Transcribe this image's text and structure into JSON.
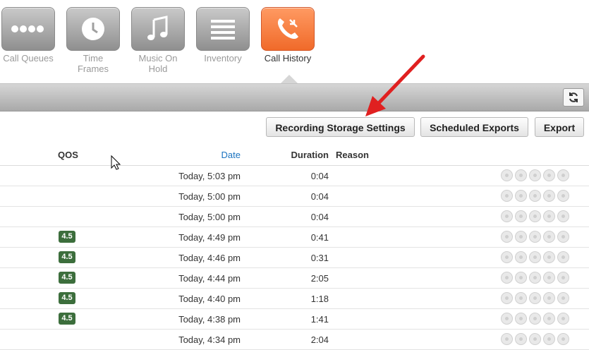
{
  "apps": [
    {
      "label": "Call Queues",
      "icon": "dots-icon",
      "active": false
    },
    {
      "label": "Time\nFrames",
      "icon": "clock-icon",
      "active": false
    },
    {
      "label": "Music On\nHold",
      "icon": "music-note-icon",
      "active": false
    },
    {
      "label": "Inventory",
      "icon": "list-icon",
      "active": false
    },
    {
      "label": "Call History",
      "icon": "phone-history-icon",
      "active": true
    }
  ],
  "toolbar": {
    "recording_storage_label": "Recording Storage Settings",
    "scheduled_exports_label": "Scheduled Exports",
    "export_label": "Export"
  },
  "table": {
    "headers": {
      "qos": "QOS",
      "date": "Date",
      "duration": "Duration",
      "reason": "Reason"
    },
    "rows": [
      {
        "qos": "",
        "date": "Today, 5:03 pm",
        "duration": "0:04"
      },
      {
        "qos": "",
        "date": "Today, 5:00 pm",
        "duration": "0:04"
      },
      {
        "qos": "",
        "date": "Today, 5:00 pm",
        "duration": "0:04"
      },
      {
        "qos": "4.5",
        "date": "Today, 4:49 pm",
        "duration": "0:41"
      },
      {
        "qos": "4.5",
        "date": "Today, 4:46 pm",
        "duration": "0:31"
      },
      {
        "qos": "4.5",
        "date": "Today, 4:44 pm",
        "duration": "2:05"
      },
      {
        "qos": "4.5",
        "date": "Today, 4:40 pm",
        "duration": "1:18"
      },
      {
        "qos": "4.5",
        "date": "Today, 4:38 pm",
        "duration": "1:41"
      },
      {
        "qos": "",
        "date": "Today, 4:34 pm",
        "duration": "2:04"
      }
    ]
  },
  "colors": {
    "accent": "#f06a2a",
    "qos_badge": "#3c6e3c",
    "date_header": "#1a73c0",
    "arrow": "#e02020"
  }
}
